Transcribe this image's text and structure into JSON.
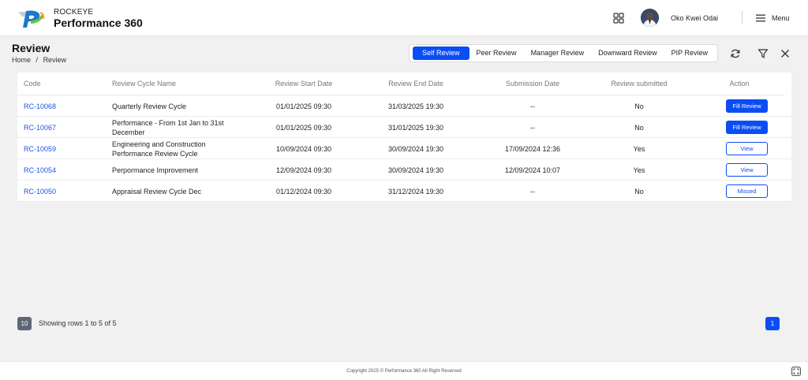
{
  "header": {
    "brand_small": "ROCKEYE",
    "brand_big": "Performance 360",
    "user_name": "Oko Kwei Odai",
    "menu_label": "Menu",
    "icons": {
      "apps": "grid-apps-icon",
      "menu": "hamburger-menu-icon"
    }
  },
  "page": {
    "title": "Review",
    "breadcrumb": {
      "home": "Home",
      "separator": "/",
      "current": "Review"
    }
  },
  "tabs": [
    {
      "label": "Self Review",
      "active": true
    },
    {
      "label": "Peer Review",
      "active": false
    },
    {
      "label": "Manager Review",
      "active": false
    },
    {
      "label": "Downward Review",
      "active": false
    },
    {
      "label": "PIP Review",
      "active": false
    }
  ],
  "toolbar": {
    "icons": [
      "refresh-icon",
      "filter-icon",
      "close-icon"
    ]
  },
  "table": {
    "columns": [
      "Code",
      "Review Cycle Name",
      "Review Start Date",
      "Review End Date",
      "Submission Date",
      "Review submitted",
      "Action"
    ],
    "rows": [
      {
        "code": "RC-10068",
        "name_line1": "Quarterly Review Cycle",
        "name_line2": "",
        "start": "01/01/2025 09:30",
        "end": "31/03/2025 19:30",
        "submission": "--",
        "submitted": "No",
        "action": "Fill Review",
        "action_style": "fill"
      },
      {
        "code": "RC-10067",
        "name_line1": "Performance - From 1st Jan to 31st",
        "name_line2": "December",
        "start": "01/01/2025 09:30",
        "end": "31/01/2025 19:30",
        "submission": "--",
        "submitted": "No",
        "action": "Fill Review",
        "action_style": "fill"
      },
      {
        "code": "RC-10059",
        "name_line1": "Engineering and Construction",
        "name_line2": "Performance Review Cycle",
        "start": "10/09/2024 09:30",
        "end": "30/09/2024 19:30",
        "submission": "17/09/2024 12:36",
        "submitted": "Yes",
        "action": "View",
        "action_style": "outline"
      },
      {
        "code": "RC-10054",
        "name_line1": "Perpormance Improvement",
        "name_line2": "",
        "start": "12/09/2024 09:30",
        "end": "30/09/2024 19:30",
        "submission": "12/09/2024 10:07",
        "submitted": "Yes",
        "action": "View",
        "action_style": "outline"
      },
      {
        "code": "RC-10050",
        "name_line1": "Appraisal Review Cycle Dec",
        "name_line2": "",
        "start": "01/12/2024 09:30",
        "end": "31/12/2024 19:30",
        "submission": "--",
        "submitted": "No",
        "action": "Missed",
        "action_style": "outline"
      }
    ]
  },
  "pagination": {
    "page_size": "10",
    "info": "Showing rows 1 to 5 of 5",
    "current_page": "1"
  },
  "footer": {
    "copyright": "Copyright 2025 © Performance 360 All Right Reserved",
    "icon": "fullscreen-icon"
  },
  "colors": {
    "accent": "#0b4df5",
    "link": "#1a56e8",
    "background": "#f1f1f1"
  }
}
